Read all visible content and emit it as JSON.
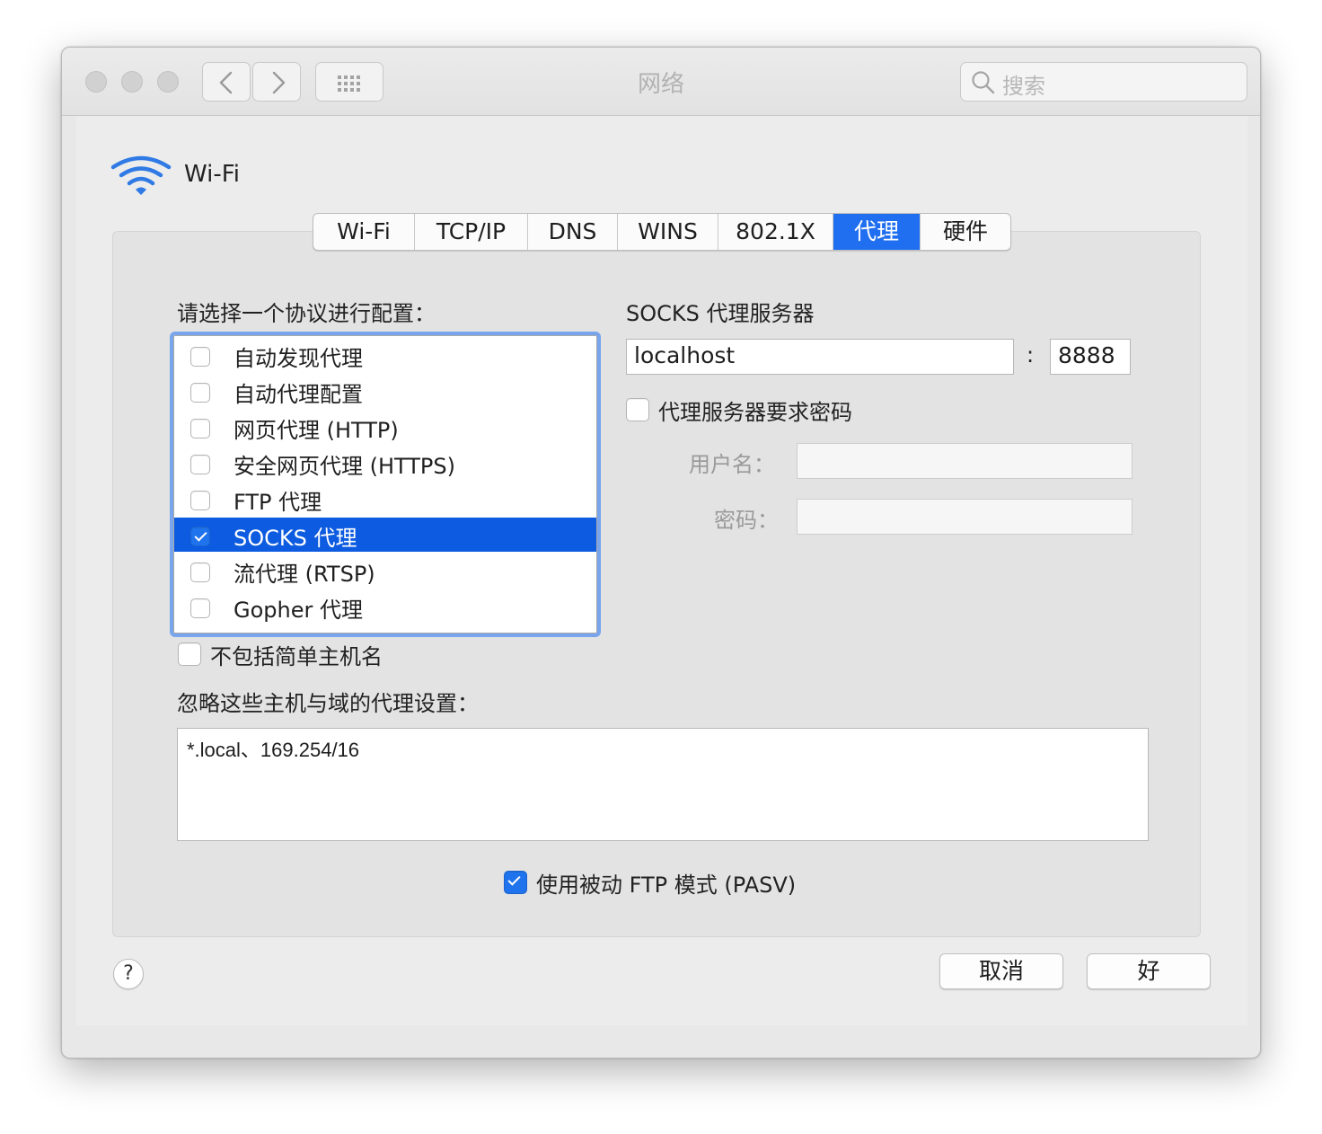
{
  "window": {
    "title": "网络",
    "search_placeholder": "搜索"
  },
  "nav": {
    "back_icon": "chevron-left-icon",
    "forward_icon": "chevron-right-icon",
    "grid_icon": "show-all-grid-icon"
  },
  "service": {
    "name": "Wi-Fi",
    "icon": "wifi-icon"
  },
  "tabs": [
    {
      "label": "Wi-Fi",
      "active": false
    },
    {
      "label": "TCP/IP",
      "active": false
    },
    {
      "label": "DNS",
      "active": false
    },
    {
      "label": "WINS",
      "active": false
    },
    {
      "label": "802.1X",
      "active": false
    },
    {
      "label": "代理",
      "active": true
    },
    {
      "label": "硬件",
      "active": false
    }
  ],
  "protocols": {
    "heading": "请选择一个协议进行配置：",
    "items": [
      {
        "label": "自动发现代理",
        "checked": false,
        "selected": false
      },
      {
        "label": "自动代理配置",
        "checked": false,
        "selected": false
      },
      {
        "label": "网页代理 (HTTP)",
        "checked": false,
        "selected": false
      },
      {
        "label": "安全网页代理 (HTTPS)",
        "checked": false,
        "selected": false
      },
      {
        "label": "FTP 代理",
        "checked": false,
        "selected": false
      },
      {
        "label": "SOCKS 代理",
        "checked": true,
        "selected": true
      },
      {
        "label": "流代理 (RTSP)",
        "checked": false,
        "selected": false
      },
      {
        "label": "Gopher 代理",
        "checked": false,
        "selected": false
      }
    ]
  },
  "server": {
    "heading": "SOCKS 代理服务器",
    "host": "localhost",
    "separator": ":",
    "port": "8888",
    "require_password_label": "代理服务器要求密码",
    "require_password": false,
    "username_label": "用户名：",
    "username": "",
    "password_label": "密码：",
    "password": ""
  },
  "exclude_simple_hostnames": {
    "label": "不包括简单主机名",
    "checked": false
  },
  "bypass": {
    "heading": "忽略这些主机与域的代理设置：",
    "value": "*.local、169.254/16"
  },
  "passive_ftp": {
    "label": "使用被动 FTP 模式 (PASV)",
    "checked": true
  },
  "buttons": {
    "help": "?",
    "cancel": "取消",
    "ok": "好"
  }
}
